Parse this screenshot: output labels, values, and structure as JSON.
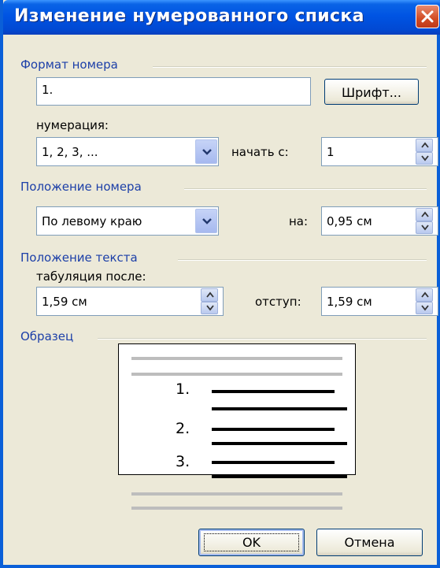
{
  "window": {
    "title": "Изменение нумерованного списка"
  },
  "format_group": {
    "title": "Формат номера",
    "format_value": "1.",
    "font_button": "Шрифт...",
    "numbering_label": "нумерация:",
    "numbering_value": "1, 2, 3, ...",
    "start_label": "начать с:",
    "start_value": "1"
  },
  "number_position": {
    "title": "Положение номера",
    "align_value": "По левому краю",
    "at_label": "на:",
    "at_value": "0,95 см"
  },
  "text_position": {
    "title": "Положение текста",
    "tab_label": "табуляция после:",
    "tab_value": "1,59 см",
    "indent_label": "отступ:",
    "indent_value": "1,59 см"
  },
  "sample": {
    "title": "Образец",
    "numbers": [
      "1.",
      "2.",
      "3."
    ]
  },
  "buttons": {
    "ok": "OK",
    "cancel": "Отмена"
  },
  "colors": {
    "titlebar": "#0054e3",
    "dialog_bg": "#ece9d8",
    "group_label": "#1c3fa8",
    "close": "#d24c24"
  },
  "icons": {
    "close": "close-icon",
    "dropdown": "chevron-down-icon",
    "spin": "spin-arrows-icon"
  }
}
